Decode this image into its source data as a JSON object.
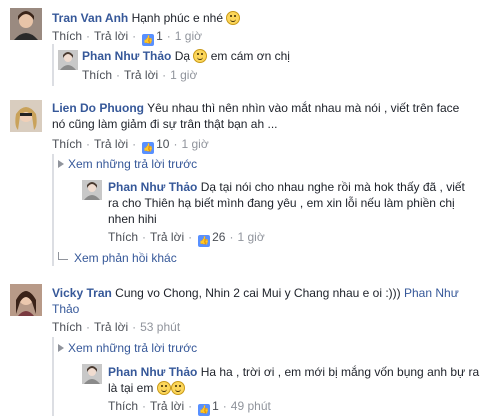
{
  "comments": [
    {
      "author": "Tran Van Anh",
      "text": "Hạnh phúc e nhé",
      "like_label": "Thích",
      "reply_label": "Trả lời",
      "like_count": "1",
      "time": "1 giờ",
      "replies": [
        {
          "author": "Phan Như Thảo",
          "text_before": "Dạ",
          "text_after": "em cám ơn chị",
          "like_label": "Thích",
          "reply_label": "Trả lời",
          "time": "1 giờ"
        }
      ]
    },
    {
      "author": "Lien Do Phuong",
      "text": "Yêu nhau thì nên nhìn vào mắt nhau mà nói , viết trên face nó cũng làm giảm đi sự trân thật bạn ah ...",
      "like_label": "Thích",
      "reply_label": "Trả lời",
      "like_count": "10",
      "time": "1 giờ",
      "more_replies": "Xem những trả lời trước",
      "replies": [
        {
          "author": "Phan Như Thảo",
          "text": "Dạ tại nói cho nhau nghe rồi mà hok thấy đã , viết ra cho Thiên hạ biết mình đang yêu , em xin lỗi nếu làm phiền chị nhen hihi",
          "like_label": "Thích",
          "reply_label": "Trả lời",
          "like_count": "26",
          "time": "1 giờ"
        }
      ],
      "other_replies": "Xem phản hồi khác"
    },
    {
      "author": "Vicky Tran",
      "text": "Cung vo Chong, Nhin 2 cai Mui y Chang nhau e oi :))) ",
      "mention": "Phan Như Thảo",
      "like_label": "Thích",
      "reply_label": "Trả lời",
      "time": "53 phút",
      "more_replies": "Xem những trả lời trước",
      "replies": [
        {
          "author": "Phan Như Thảo",
          "text": "Ha ha , trời ơi , em mới bị mắng vốn bụng anh bự ra là tại em",
          "like_label": "Thích",
          "reply_label": "Trả lời",
          "like_count": "1",
          "time": "49 phút"
        }
      ]
    }
  ],
  "colors": {
    "author": "#365899",
    "meta": "#90949c",
    "text": "#1d2129",
    "like_badge": "#5890ff"
  }
}
